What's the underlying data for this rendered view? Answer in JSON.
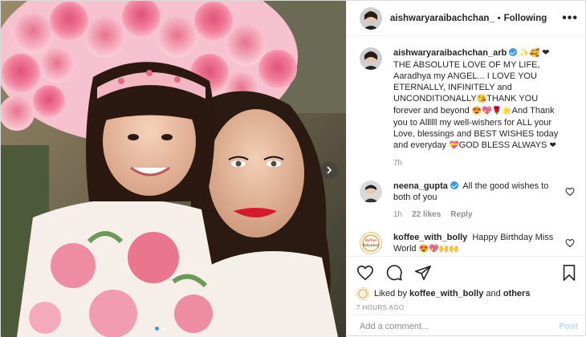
{
  "header": {
    "username": "aishwaryaraibachchan_",
    "separator": "•",
    "follow_state": "Following",
    "more_glyph": "•••"
  },
  "caption": {
    "author": "aishwaryaraibachchan_arb",
    "emoji_after_author": "✨🥰",
    "text_1": "❤THE ABSOLUTE LOVE OF MY LIFE, Aaradhya my ANGEL... I LOVE YOU ETERNALLY, INFINITELY and UNCONDITIONALLY",
    "emoji_1": "😘",
    "text_2": "THANK YOU forever and beyond",
    "emoji_2": "😍💖🌹🌟",
    "text_3": "And Thank you to Allllll my well-wishers for ALL your Love, blessings and BEST WISHES today and everyday",
    "emoji_3": "💝",
    "text_4": "GOD BLESS ALWAYS",
    "emoji_4": "❤",
    "time": "7h"
  },
  "comments": [
    {
      "author": "neena_gupta",
      "text": "All the good wishes to both of you",
      "time": "1h",
      "likes": "22 likes",
      "reply": "Reply"
    },
    {
      "author": "koffee_with_bolly",
      "text": "Happy Birthday Miss World",
      "emoji": "😍💖🙌🙌",
      "avatar_text": "Koffee Bollywood"
    }
  ],
  "likes": {
    "prefix": "Liked by",
    "user": "koffee_with_bolly",
    "joiner": "and",
    "others": "others"
  },
  "timestamp": "7 HOURS AGO",
  "add_comment": {
    "placeholder": "Add a comment...",
    "post_label": "Post"
  },
  "colors": {
    "accent_blue": "#3897f0",
    "post_disabled": "#b2dffc",
    "like_red": "#ed4956"
  },
  "icons": [
    "heart-icon",
    "comment-icon",
    "share-icon",
    "bookmark-icon",
    "verified-icon",
    "chevron-right-icon",
    "more-icon"
  ],
  "carousel": {
    "slides": 2,
    "active": 1
  }
}
